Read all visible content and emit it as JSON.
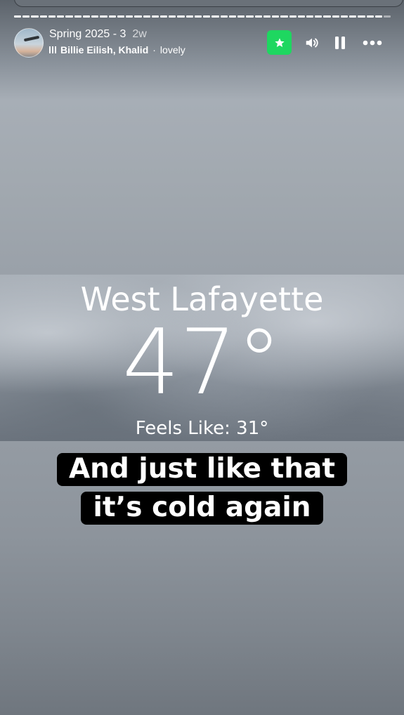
{
  "story": {
    "title": "Spring 2025 - 3",
    "age": "2w",
    "progress_segments_total": 44,
    "progress_segments_viewed": 43
  },
  "music": {
    "artists": "Billie Eilish, Khalid",
    "separator": "·",
    "song": "lovely"
  },
  "controls": {
    "close_friends_icon": "star-icon",
    "close_friends_color": "#1ed760",
    "volume_icon": "speaker-icon",
    "pause_icon": "pause-icon",
    "more_icon": "more-icon"
  },
  "weather": {
    "city": "West Lafayette",
    "temperature": "47°",
    "feels_like": "Feels Like: 31°"
  },
  "caption": {
    "line1": "And just like that",
    "line2": "it’s cold again"
  }
}
